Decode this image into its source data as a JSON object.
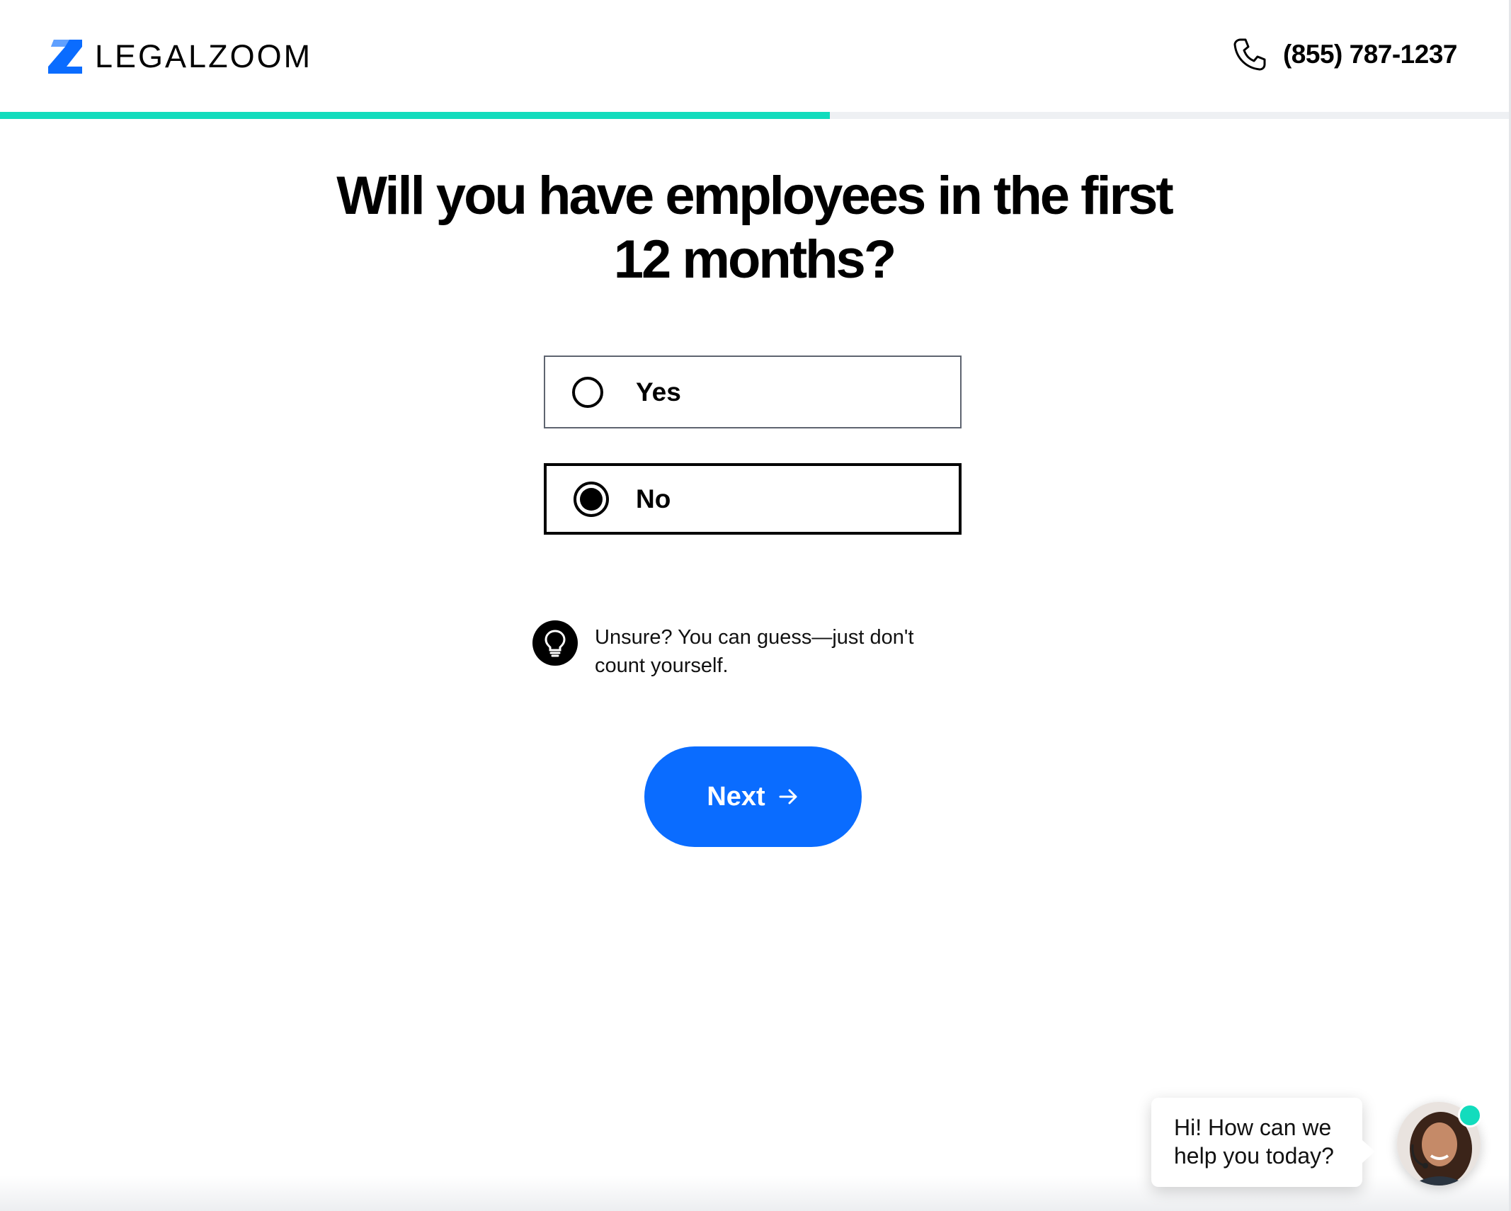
{
  "header": {
    "logo_text": "LEGALZOOM",
    "phone": "(855) 787-1237",
    "icons": {
      "logo": "legalzoom-logo-icon",
      "phone": "phone-icon"
    }
  },
  "progress": {
    "fraction": 0.55,
    "color": "#12dcbd"
  },
  "question": {
    "line1": "Will you have employees in the first",
    "line2": "12 months?"
  },
  "options": [
    {
      "label": "Yes",
      "selected": false
    },
    {
      "label": "No",
      "selected": true
    }
  ],
  "hint": {
    "icon": "lightbulb-icon",
    "line1": "Unsure? You can guess—just don't",
    "line2": "count yourself."
  },
  "next_button": {
    "label": "Next",
    "icon": "arrow-right-icon",
    "color": "#0a6cff"
  },
  "chat": {
    "line1": "Hi! How can we",
    "line2": "help you today?",
    "status_color": "#12dcbd"
  }
}
